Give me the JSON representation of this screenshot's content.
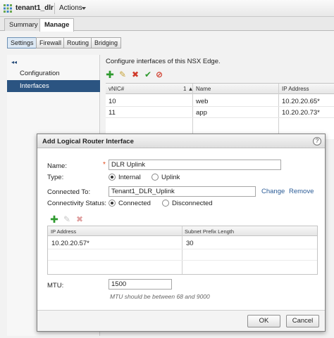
{
  "header": {
    "title": "tenant1_dlr",
    "actions_label": "Actions"
  },
  "tabs": [
    {
      "label": "Summary"
    },
    {
      "label": "Manage"
    }
  ],
  "subtabs": [
    {
      "label": "Settings"
    },
    {
      "label": "Firewall"
    },
    {
      "label": "Routing"
    },
    {
      "label": "Bridging"
    }
  ],
  "sidebar": {
    "collapse_glyph": "◂◂",
    "items": [
      {
        "label": "Configuration"
      },
      {
        "label": "Interfaces"
      }
    ]
  },
  "main": {
    "description": "Configure interfaces of this NSX Edge.",
    "columns": [
      "vNIC#",
      "Name",
      "IP Address"
    ],
    "sort_indicator": "1 ▲",
    "rows": [
      {
        "vnic": "10",
        "name": "web",
        "ip": "10.20.20.65*"
      },
      {
        "vnic": "11",
        "name": "app",
        "ip": "10.20.20.73*"
      }
    ]
  },
  "dialog": {
    "title": "Add Logical Router Interface",
    "help_glyph": "?",
    "required_mark": "*",
    "name_label": "Name:",
    "name_value": "DLR Uplink",
    "type_label": "Type:",
    "type_options": [
      "Internal",
      "Uplink"
    ],
    "type_selected": "Internal",
    "connected_to_label": "Connected To:",
    "connected_to_value": "Tenant1_DLR_Uplink",
    "change_label": "Change",
    "remove_label": "Remove",
    "connectivity_label": "Connectivity Status:",
    "connectivity_options": [
      "Connected",
      "Disconnected"
    ],
    "connectivity_selected": "Connected",
    "ip_columns": [
      "IP Address",
      "Subnet Prefix Length"
    ],
    "ip_rows": [
      {
        "ip": "10.20.20.57*",
        "prefix": "30"
      }
    ],
    "mtu_label": "MTU:",
    "mtu_value": "1500",
    "mtu_hint": "MTU should be between 68 and 9000",
    "ok_label": "OK",
    "cancel_label": "Cancel"
  },
  "colors": {
    "selection_blue": "#2b5481",
    "add_green": "#2f9a2f",
    "delete_red": "#d03a2a",
    "link_blue": "#2a5b96"
  },
  "icons": [
    "app-grid-icon",
    "add-icon",
    "edit-icon",
    "delete-icon",
    "enable-icon",
    "disable-icon",
    "help-icon"
  ]
}
